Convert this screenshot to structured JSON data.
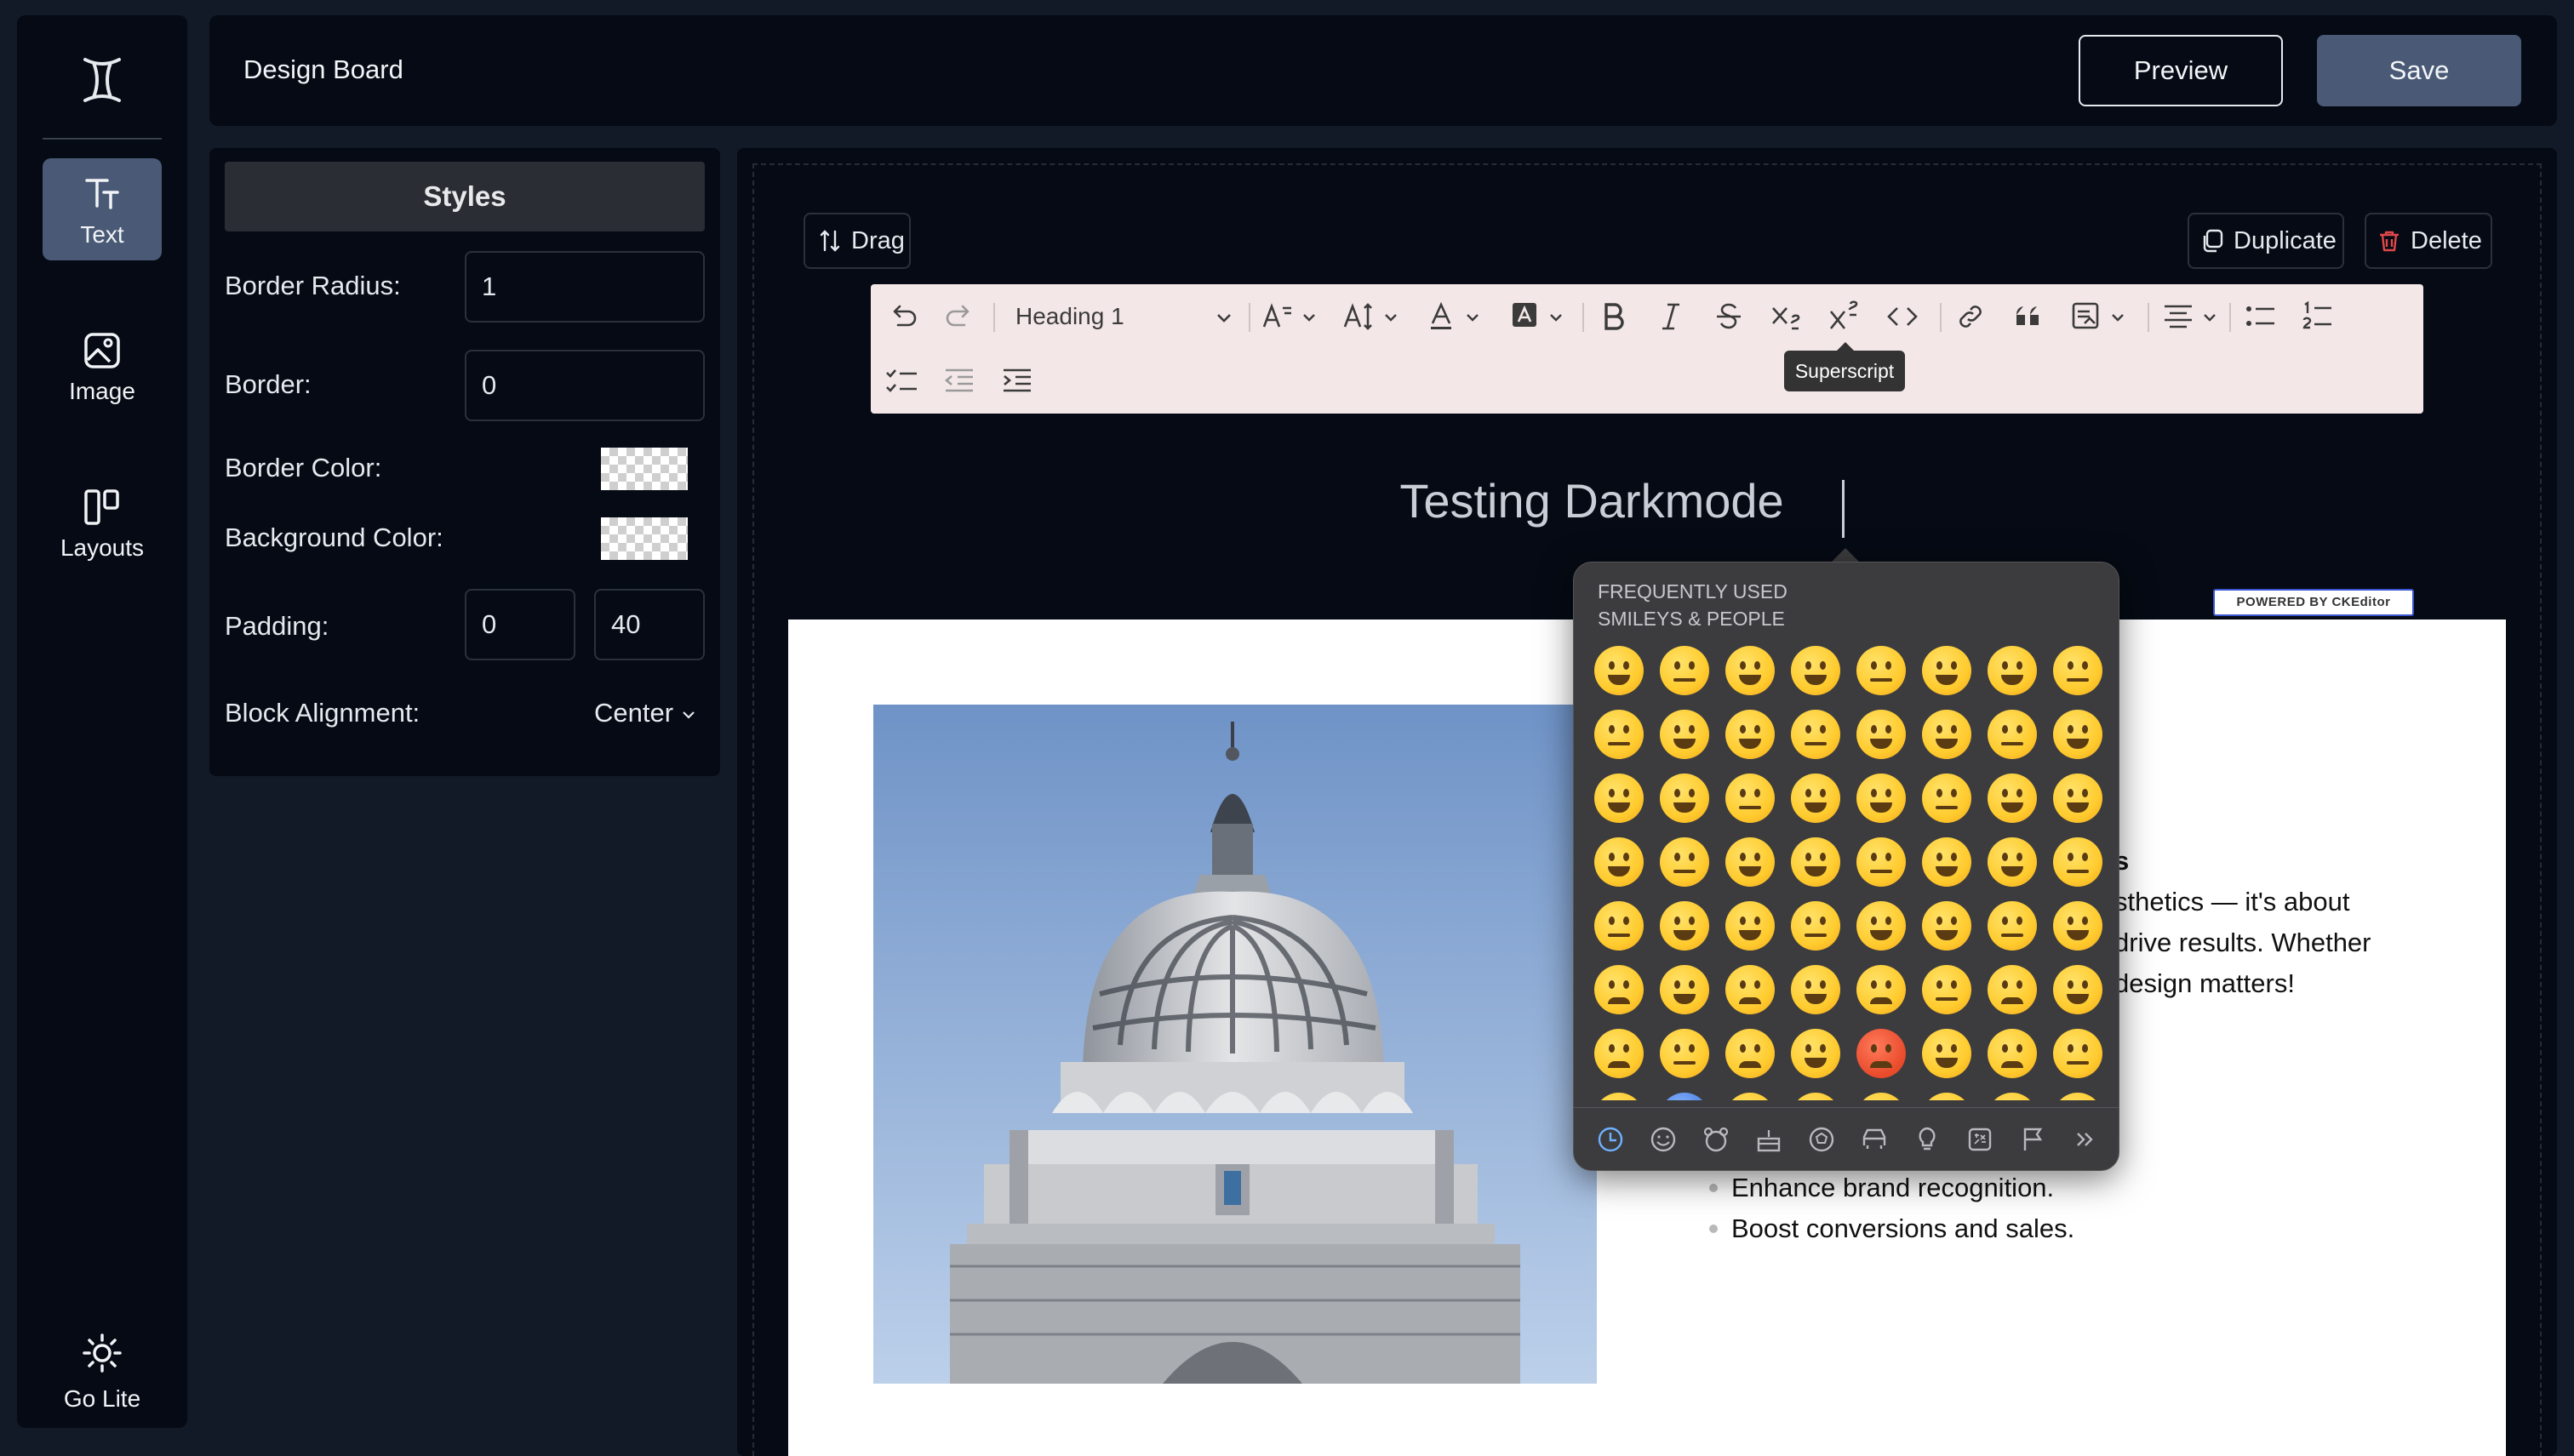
{
  "app": {
    "title": "Design Board"
  },
  "header": {
    "preview_label": "Preview",
    "save_label": "Save"
  },
  "rail": {
    "items": [
      {
        "label": "Text",
        "icon": "text-icon",
        "active": true
      },
      {
        "label": "Image",
        "icon": "image-icon",
        "active": false
      },
      {
        "label": "Layouts",
        "icon": "layouts-icon",
        "active": false
      }
    ],
    "theme_label": "Go Lite",
    "theme_icon": "sun-icon"
  },
  "styles": {
    "heading": "Styles",
    "border_radius_label": "Border Radius:",
    "border_radius_value": "1",
    "border_label": "Border:",
    "border_value": "0",
    "border_color_label": "Border Color:",
    "background_color_label": "Background Color:",
    "padding_label": "Padding:",
    "padding_left": "0",
    "padding_right": "40",
    "block_alignment_label": "Block Alignment:",
    "block_alignment_value": "Center"
  },
  "block": {
    "drag_label": "Drag",
    "duplicate_label": "Duplicate",
    "delete_label": "Delete"
  },
  "editor": {
    "heading_style": "Heading 1",
    "tooltip": "Superscript",
    "heading_text": "Testing Darkmode",
    "powered_by": "POWERED BY  CKEditor"
  },
  "content": {
    "partial_bold": "s",
    "lines": [
      "sthetics — it's about",
      "drive results. Whether",
      " design matters!"
    ],
    "bullets": [
      "Enhance brand recognition.",
      "Boost conversions and sales."
    ]
  },
  "emoji_picker": {
    "section_line1": "FREQUENTLY USED",
    "section_line2": "SMILEYS & PEOPLE",
    "tabs": [
      "clock-icon",
      "smiley-icon",
      "bear-icon",
      "cake-icon",
      "ball-icon",
      "car-icon",
      "bulb-icon",
      "symbols-icon",
      "flag-icon",
      "more-icon"
    ]
  },
  "colors": {
    "accent": "#4a5a76",
    "panel_bg": "#050a14",
    "page_bg": "#121a27",
    "toolbar_bg": "#f4e7e7"
  }
}
